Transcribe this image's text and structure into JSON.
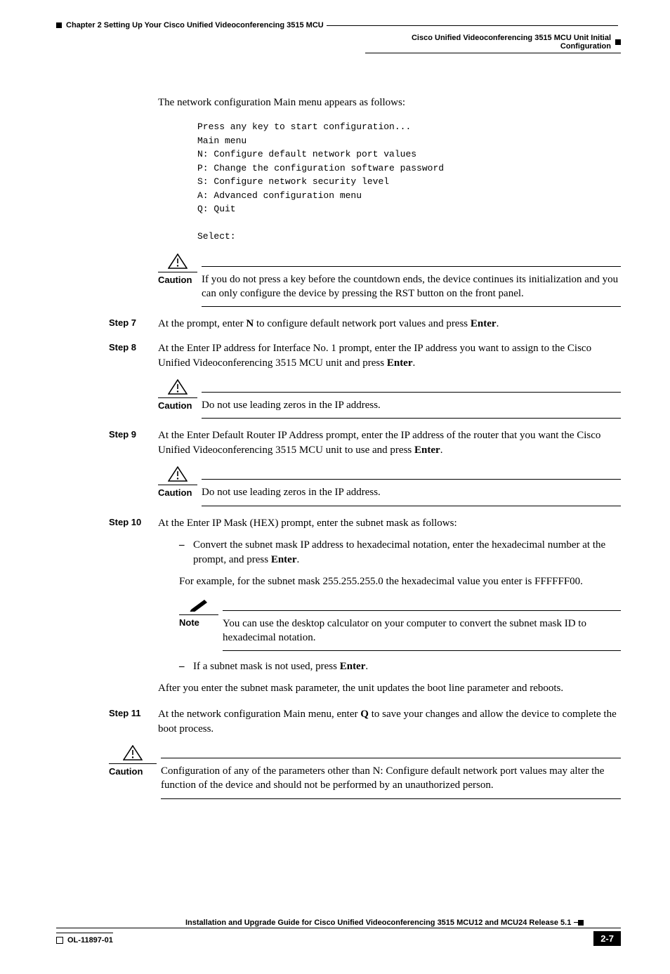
{
  "header": {
    "chapter": "Chapter 2      Setting Up Your Cisco Unified Videoconferencing 3515 MCU",
    "section": "Cisco Unified Videoconferencing 3515 MCU Unit Initial Configuration"
  },
  "intro": "The network configuration Main menu appears as follows:",
  "code": "Press any key to start configuration...\nMain menu\nN: Configure default network port values\nP: Change the configuration software password\nS: Configure network security level\nA: Advanced configuration menu\nQ: Quit\n\nSelect:",
  "caution1": {
    "label": "Caution",
    "text": "If you do not press a key before the countdown ends, the device continues its initialization and you can only configure the device by pressing the RST button on the front panel."
  },
  "step7": {
    "label": "Step 7",
    "pre": "At the prompt, enter ",
    "bold1": "N",
    "mid": " to configure default network port values and press ",
    "bold2": "Enter",
    "post": "."
  },
  "step8": {
    "label": "Step 8",
    "pre": "At the Enter IP address for Interface No. 1 prompt, enter the IP address you want to assign to the Cisco Unified Videoconferencing 3515 MCU unit and press ",
    "bold": "Enter",
    "post": "."
  },
  "caution2": {
    "label": "Caution",
    "text": "Do not use leading zeros in the IP address."
  },
  "step9": {
    "label": "Step 9",
    "pre": "At the Enter Default Router IP Address prompt, enter the IP address of the router that you want the Cisco Unified Videoconferencing 3515 MCU unit to use and press ",
    "bold": "Enter",
    "post": "."
  },
  "caution3": {
    "label": "Caution",
    "text": "Do not use leading zeros in the IP address."
  },
  "step10": {
    "label": "Step 10",
    "text": "At the Enter IP Mask (HEX) prompt, enter the subnet mask as follows:",
    "bullet1_pre": "Convert the subnet mask IP address to hexadecimal notation, enter the hexadecimal number at the prompt, and press ",
    "bullet1_bold": "Enter",
    "bullet1_post": ".",
    "example": "For example, for the subnet mask 255.255.255.0 the hexadecimal value you enter is FFFFFF00.",
    "note_label": "Note",
    "note_text": "You can use the desktop calculator on your computer to convert the subnet mask ID to hexadecimal notation.",
    "bullet2_pre": "If a subnet mask is not used, press ",
    "bullet2_bold": "Enter",
    "bullet2_post": ".",
    "after": "After you enter the subnet mask parameter, the unit updates the boot line parameter and reboots."
  },
  "step11": {
    "label": "Step 11",
    "pre": "At the network configuration Main menu, enter ",
    "bold1": "Q",
    "post": " to save your changes and allow the device to complete the boot process."
  },
  "caution4": {
    "label": "Caution",
    "text": "Configuration of any of the parameters other than N: Configure default network port values may alter the function of the device and should not be performed by an unauthorized person."
  },
  "footer": {
    "title": "Installation and Upgrade Guide for Cisco Unified Videoconferencing 3515 MCU12 and MCU24 Release 5.1",
    "docid": "OL-11897-01",
    "pagenum": "2-7"
  }
}
